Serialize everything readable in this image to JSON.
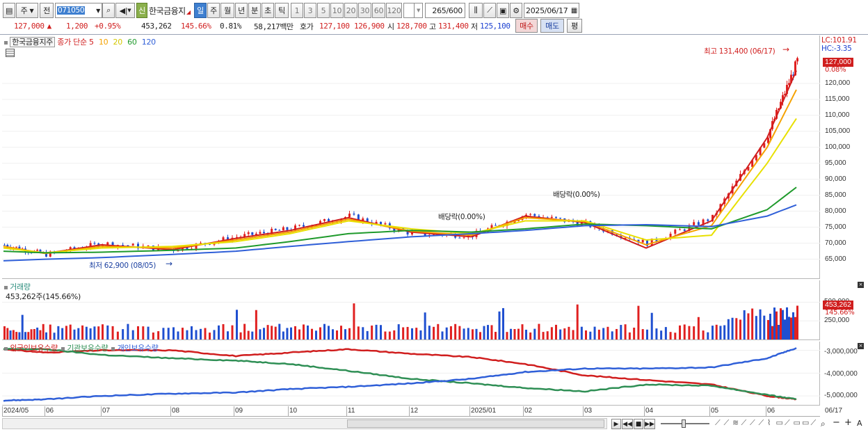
{
  "toolbar": {
    "period_selected": "주",
    "prev_label": "전",
    "stock_code": "071050",
    "stock_name": "한국금융지",
    "credit_badge": "신",
    "periods": [
      "일",
      "주",
      "월",
      "년",
      "분",
      "초",
      "틱"
    ],
    "active_period": "일",
    "intervals": [
      "1",
      "3",
      "5",
      "10",
      "20",
      "30",
      "60",
      "120"
    ],
    "count": "265",
    "count_total": "/600",
    "date": "2025/06/17"
  },
  "quote": {
    "price": "127,000",
    "change": "1,200",
    "change_pct": "+0.95%",
    "volume": "453,262",
    "volume_ratio": "145.66%",
    "turnover": "0.81%",
    "amount": "58,217백만",
    "bid_label": "호가",
    "ask_price": "127,100",
    "bid_price": "126,900",
    "open_label": "시",
    "open": "128,700",
    "high_label": "고",
    "high": "131,400",
    "low_label": "저",
    "low": "125,100",
    "buy_label": "매수",
    "sell_label": "매도",
    "avg_label": "평"
  },
  "price_panel": {
    "stock_name": "한국금융지주",
    "indicator": "종가 단순",
    "ma_periods": [
      "5",
      "10",
      "20",
      "60",
      "120"
    ],
    "ma_colors": [
      "#d01e1e",
      "#f5a200",
      "#e8e000",
      "#1f9a2c",
      "#2f5fd8"
    ],
    "lc": "LC:101.91",
    "hc": "HC:-3.35",
    "last_price": "127,000",
    "last_pct": "0.08%",
    "high_annotation": "최고 131,400 (06/17)",
    "low_annotation": "최저 62,900 (08/05)",
    "dividend_1": "배당락(0.00%)",
    "dividend_2": "배당락(0.00%)",
    "yticks": [
      "120,000",
      "115,000",
      "110,000",
      "105,000",
      "100,000",
      "95,000",
      "90,000",
      "85,000",
      "80,000",
      "75,000",
      "70,000",
      "65,000"
    ]
  },
  "volume_panel": {
    "title": "거래량",
    "summary": "453,262주(145.66%)",
    "last": "453,262",
    "last_pct": "145.66%",
    "yticks": [
      "500,000",
      "250,000"
    ]
  },
  "holdings_panel": {
    "series": [
      "외국인보유수량",
      "기관보유수량",
      "개인보유수량"
    ],
    "colors": [
      "#d01e1e",
      "#2f8f55",
      "#2f5fd8"
    ],
    "yticks": [
      "-3,000,000",
      "-4,000,000",
      "-5,000,000"
    ]
  },
  "xaxis": {
    "labels": [
      "2024/05",
      "06",
      "07",
      "08",
      "09",
      "10",
      "11",
      "12",
      "2025/01",
      "02",
      "03",
      "04",
      "05",
      "06"
    ],
    "end_label": "06/17"
  },
  "chart_data": {
    "type": "line",
    "title": "한국금융지주",
    "x": [
      "2024/05",
      "2024/06",
      "2024/07",
      "2024/08",
      "2024/09",
      "2024/10",
      "2024/11",
      "2024/12",
      "2025/01",
      "2025/02",
      "2025/03",
      "2025/04",
      "2025/05",
      "2025/06",
      "2025/06/17"
    ],
    "series": [
      {
        "name": "종가",
        "values": [
          69500,
          66500,
          70000,
          68000,
          72000,
          74500,
          78500,
          73000,
          72500,
          79000,
          76000,
          70000,
          78000,
          104000,
          127000
        ]
      },
      {
        "name": "5",
        "values": [
          69000,
          66800,
          69500,
          68000,
          71500,
          74000,
          78000,
          73500,
          72000,
          78500,
          76500,
          68500,
          77000,
          103000,
          124000
        ]
      },
      {
        "name": "10",
        "values": [
          69000,
          66800,
          69000,
          68500,
          71000,
          73500,
          77500,
          73800,
          72500,
          78000,
          76800,
          69500,
          75500,
          100000,
          118000
        ]
      },
      {
        "name": "20",
        "values": [
          68500,
          67000,
          68500,
          69000,
          70500,
          73000,
          77000,
          74500,
          73000,
          77000,
          77000,
          71000,
          72500,
          95000,
          109000
        ]
      },
      {
        "name": "60",
        "values": [
          67500,
          67000,
          67200,
          67800,
          68500,
          70500,
          73000,
          74000,
          73500,
          74500,
          76000,
          75500,
          74500,
          80500,
          87500
        ]
      },
      {
        "name": "120",
        "values": [
          64500,
          65000,
          65500,
          66500,
          67500,
          69000,
          70500,
          72000,
          73000,
          74000,
          75500,
          75800,
          75200,
          78500,
          82000
        ]
      }
    ],
    "extra": {
      "high": 131400,
      "high_date": "06/17",
      "low": 62900,
      "low_date": "08/05",
      "last": 127000,
      "volume_last": 453262,
      "holdings": {
        "외국인보유수량": [
          -2950000,
          -3100000,
          -3000000,
          -3000000,
          -3250000,
          -3100000,
          -2950000,
          -3150000,
          -3300000,
          -3600000,
          -4100000,
          -4300000,
          -4500000,
          -5000000,
          -5150000
        ],
        "기관보유수량": [
          -2950000,
          -2950000,
          -3200000,
          -3350000,
          -3450000,
          -3600000,
          -3900000,
          -4250000,
          -4450000,
          -4650000,
          -4800000,
          -4500000,
          -4550000,
          -4950000,
          -5150000
        ],
        "개인보유수량": [
          -5200000,
          -5150000,
          -5000000,
          -4900000,
          -4850000,
          -4700000,
          -4600000,
          -4450000,
          -4250000,
          -3950000,
          -3800000,
          -3800000,
          -3750000,
          -3350000,
          -2900000
        ]
      }
    }
  },
  "footer": {
    "buttons": [
      "▶",
      "◀◀",
      "■",
      "▶▶"
    ],
    "zoom": "A"
  }
}
